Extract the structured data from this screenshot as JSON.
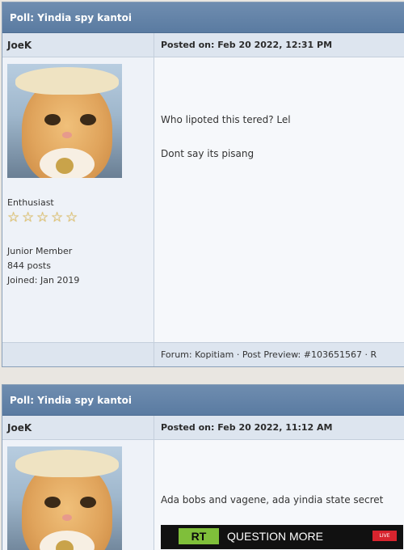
{
  "posts": [
    {
      "thread_title": "Poll: Yindia spy kantoi",
      "author": "JoeK",
      "posted": "Posted on: Feb 20 2022, 12:31 PM",
      "rank": "Enthusiast",
      "member_level": "Junior Member",
      "post_count": "844 posts",
      "joined": "Joined: Jan 2019",
      "message_lines": [
        "Who lipoted this tered? Lel",
        "Dont say its pisang"
      ],
      "footer": "Forum: Kopitiam · Post Preview: #103651567 · R"
    },
    {
      "thread_title": "Poll: Yindia spy kantoi",
      "author": "JoeK",
      "posted": "Posted on: Feb 20 2022, 11:12 AM",
      "message_lines": [
        "Ada bobs and vagene, ada yindia state secret"
      ],
      "video": {
        "logo": "RT",
        "tagline": "QUESTION MORE",
        "badge": "LIVE"
      }
    }
  ],
  "icons": {
    "star": "star-icon"
  },
  "colors": {
    "title_bar": "#6f8db0",
    "header_row": "#dde5ef",
    "star": "#e8c767"
  }
}
